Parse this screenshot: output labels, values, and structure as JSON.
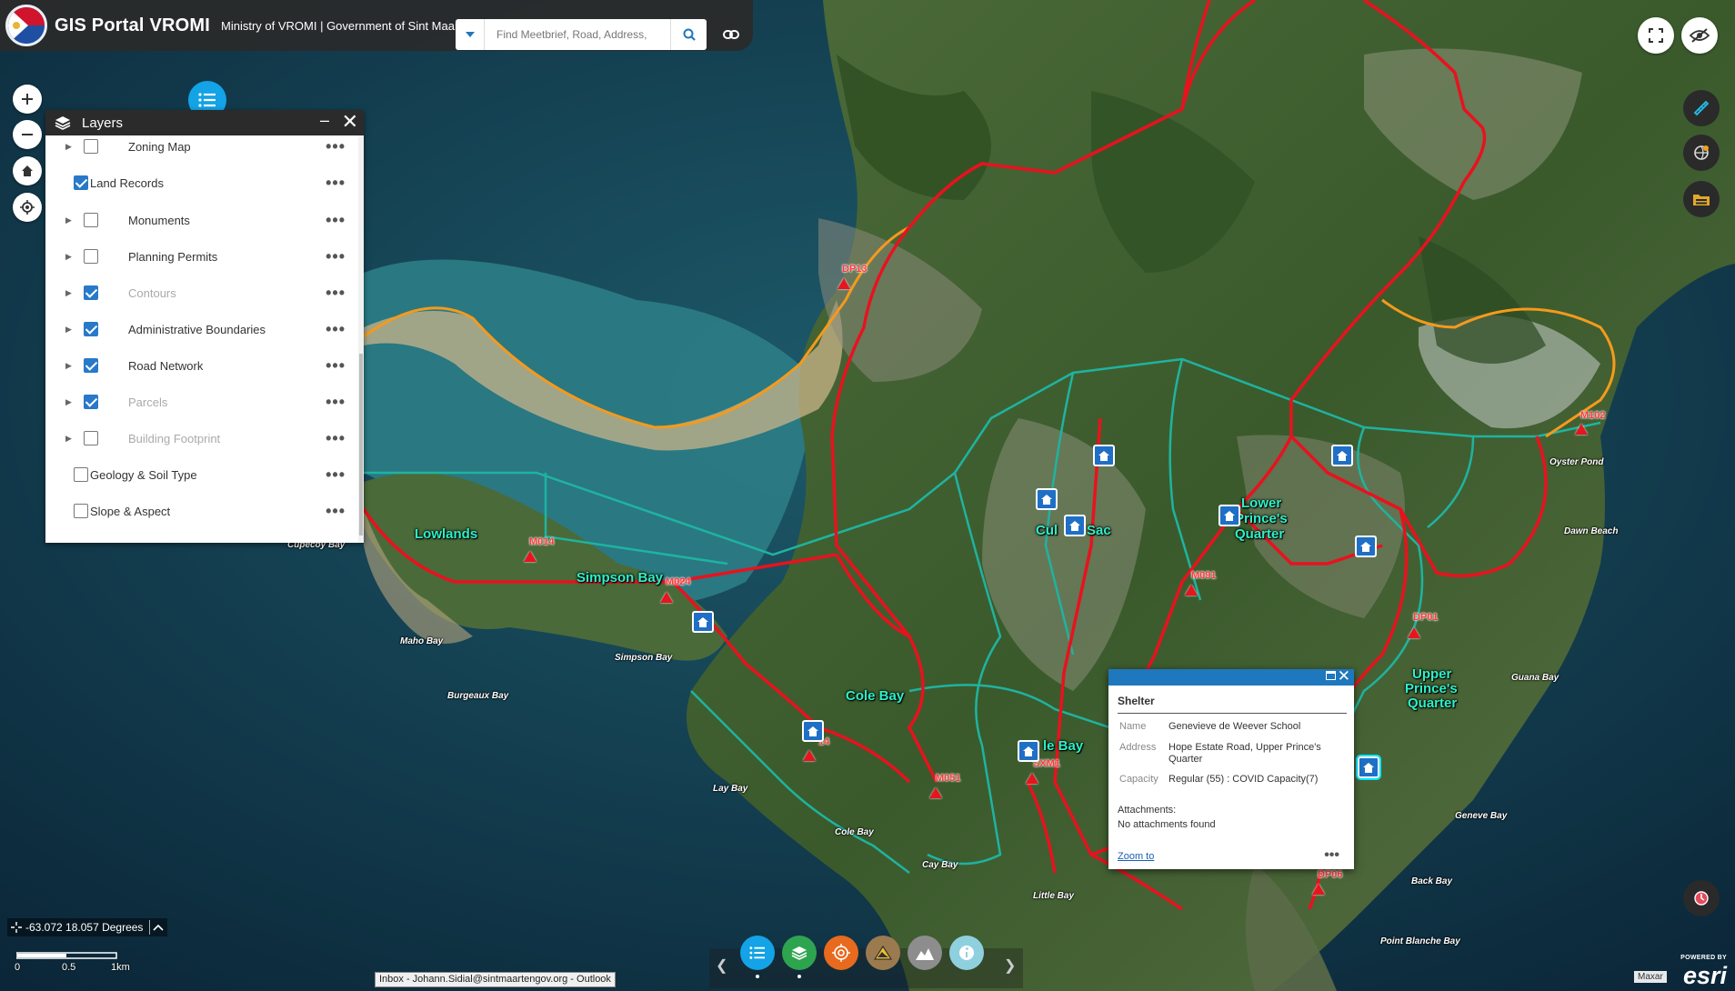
{
  "header": {
    "title": "GIS Portal VROMI",
    "subtitle": "Ministry of VROMI | Government of Sint Maarten",
    "search_placeholder": "Find Meetbrief, Road, Address,"
  },
  "layers_panel": {
    "title": "Layers",
    "items": [
      {
        "label": "Zoning Map",
        "checked": false,
        "expandable": true,
        "dimmed": false
      },
      {
        "label": "Land Records",
        "checked": true,
        "expandable": false,
        "dimmed": false
      },
      {
        "label": "Monuments",
        "checked": false,
        "expandable": true,
        "dimmed": false
      },
      {
        "label": "Planning Permits",
        "checked": false,
        "expandable": true,
        "dimmed": false
      },
      {
        "label": "Contours",
        "checked": true,
        "expandable": true,
        "dimmed": true
      },
      {
        "label": "Administrative Boundaries",
        "checked": true,
        "expandable": true,
        "dimmed": false
      },
      {
        "label": "Road Network",
        "checked": true,
        "expandable": true,
        "dimmed": false
      },
      {
        "label": "Parcels",
        "checked": true,
        "expandable": true,
        "dimmed": true
      },
      {
        "label": "Building Footprint",
        "checked": false,
        "expandable": true,
        "dimmed": true
      },
      {
        "label": "Geology & Soil Type",
        "checked": false,
        "expandable": false,
        "dimmed": false
      },
      {
        "label": "Slope & Aspect",
        "checked": false,
        "expandable": false,
        "dimmed": false
      }
    ]
  },
  "map": {
    "places": [
      "Lowlands",
      "Simpson Bay",
      "Cole Bay",
      "Cul",
      "Sac",
      "Lower",
      "Prince's",
      "Quarter",
      "Upper",
      "Prince's",
      "Quarter",
      "le Bay"
    ],
    "bays": [
      "Maho Bay",
      "Simpson Bay",
      "Burgeaux Bay",
      "Lay Bay",
      "Cole Bay",
      "Cay Bay",
      "Little Bay",
      "Oyster Pond",
      "Dawn Beach",
      "Guana Bay",
      "Geneve Bay",
      "Back Bay",
      "Point Blanche Bay",
      "Cupecoy Bay"
    ],
    "monuments": [
      "DP13",
      "M014",
      "M024",
      "M091",
      "M102",
      "DP01",
      "M051",
      "SXM1",
      "DP06",
      "14"
    ]
  },
  "popup": {
    "title": "Shelter",
    "fields": [
      {
        "key": "Name",
        "value": "Genevieve de Weever School"
      },
      {
        "key": "Address",
        "value": "Hope Estate Road, Upper Prince's Quarter"
      },
      {
        "key": "Capacity",
        "value": "Regular (55) : COVID Capacity(7)"
      }
    ],
    "attachments_label": "Attachments:",
    "attachments_value": "No attachments found",
    "zoom_label": "Zoom to"
  },
  "status": {
    "coordinates": "-63.072 18.057 Degrees",
    "scale_labels": [
      "0",
      "0.5",
      "1km"
    ],
    "taskbar_tooltip": "Inbox - Johann.Sidial@sintmaartengov.org - Outlook",
    "attribution": "Maxar",
    "esri_powered": "POWERED BY",
    "esri_name": "esri"
  },
  "colors": {
    "road_primary": "#e8121e",
    "road_secondary": "#f59a1b",
    "boundary": "#1fb3a0",
    "accent": "#13a3e6",
    "header_bg": "#2a2a2a"
  }
}
